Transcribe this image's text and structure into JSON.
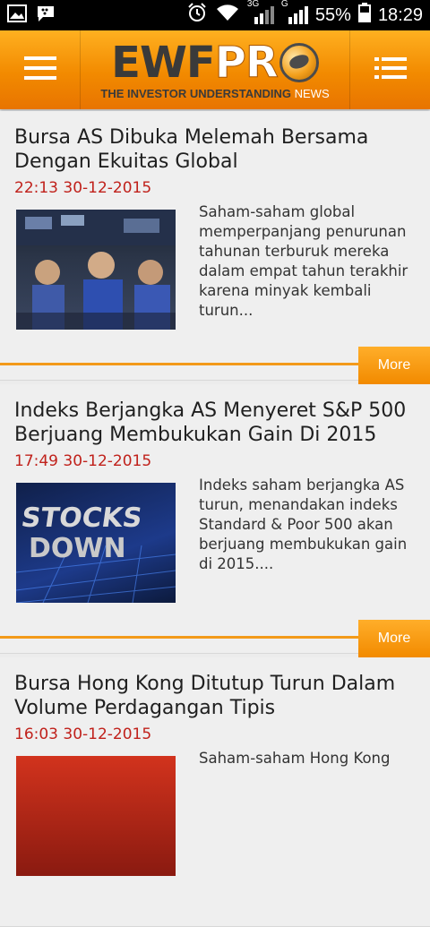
{
  "status": {
    "battery": "55%",
    "time": "18:29",
    "net1": "3G",
    "net2": "G"
  },
  "brand": {
    "logo_a": "EWF",
    "logo_b": "PR",
    "tagline": "THE INVESTOR UNDERSTANDING",
    "tagline_news": "NEWS"
  },
  "articles": [
    {
      "title": "Bursa AS Dibuka Melemah Bersama Dengan Ekuitas Global",
      "time": "22:13 30-12-2015",
      "summary": "Saham-saham global memperpanjang penurunan tahunan terburuk mereka dalam empat tahun terakhir karena minyak kembali turun...",
      "more": "More"
    },
    {
      "title": "Indeks Berjangka AS Menyeret S&P 500 Berjuang Membukukan Gain Di 2015",
      "time": "17:49 30-12-2015",
      "summary": "Indeks saham berjangka AS turun, menandakan indeks Standard & Poor 500 akan berjuang membukukan gain di 2015....",
      "more": "More",
      "thumb_text_1": "STOCKS",
      "thumb_text_2": "DOWN"
    },
    {
      "title": "Bursa Hong Kong Ditutup Turun Dalam Volume Perdagangan Tipis",
      "time": "16:03 30-12-2015",
      "summary": "Saham-saham Hong Kong",
      "more": "More"
    }
  ]
}
